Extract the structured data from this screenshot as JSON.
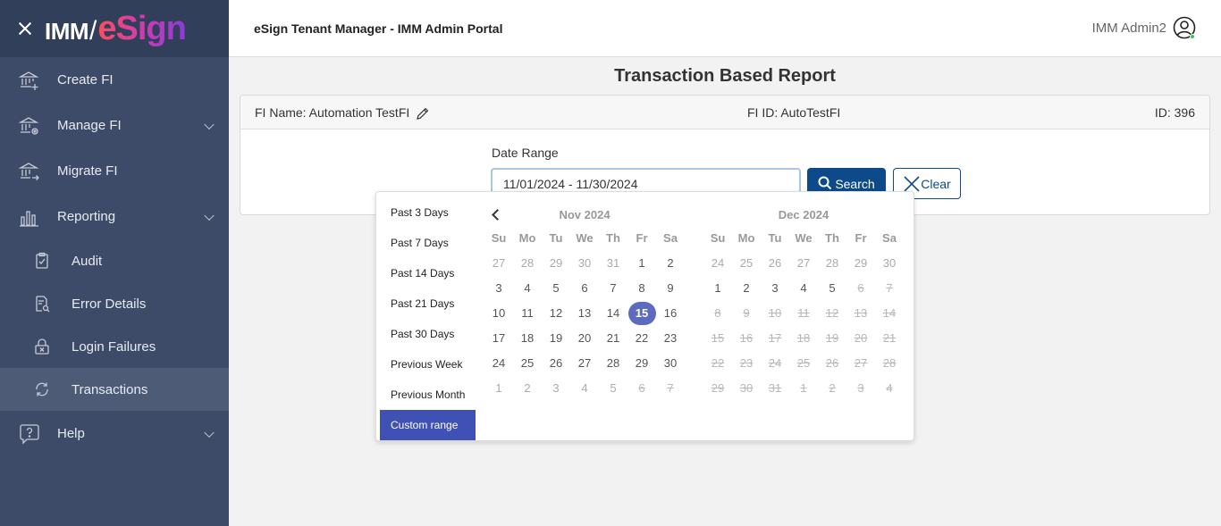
{
  "brand": {
    "imm": "IMM",
    "slash": "/",
    "esign": "eSign"
  },
  "sidebar": {
    "items": [
      {
        "label": "Create FI",
        "icon": "bank-plus-icon"
      },
      {
        "label": "Manage FI",
        "icon": "bank-gear-icon"
      },
      {
        "label": "Migrate FI",
        "icon": "bank-arrow-icon"
      },
      {
        "label": "Reporting",
        "icon": "bar-chart-icon"
      }
    ],
    "reporting_sub": [
      {
        "label": "Audit",
        "icon": "clipboard-check-icon"
      },
      {
        "label": "Error Details",
        "icon": "document-search-icon"
      },
      {
        "label": "Login Failures",
        "icon": "lock-x-icon"
      },
      {
        "label": "Transactions",
        "icon": "sync-icon"
      }
    ],
    "help": {
      "label": "Help",
      "icon": "help-bubble-icon"
    }
  },
  "header": {
    "title": "eSign Tenant Manager - IMM Admin Portal",
    "user": "IMM Admin2"
  },
  "page": {
    "title": "Transaction Based Report",
    "fi_name": "FI Name: Automation TestFI",
    "fi_id": "FI ID: AutoTestFI",
    "id": "ID: 396",
    "date_label": "Date Range",
    "date_value": "11/01/2024 - 11/30/2024",
    "search_label": "Search",
    "clear_label": "Clear"
  },
  "picker": {
    "ranges": [
      "Past 3 Days",
      "Past 7 Days",
      "Past 14 Days",
      "Past 21 Days",
      "Past 30 Days",
      "Previous Week",
      "Previous Month",
      "Custom range"
    ],
    "active_range": "Custom range",
    "dow": [
      "Su",
      "Mo",
      "Tu",
      "We",
      "Th",
      "Fr",
      "Sa"
    ],
    "left": {
      "month": "Nov 2024",
      "days": [
        {
          "d": "27",
          "s": "off"
        },
        {
          "d": "28",
          "s": "off"
        },
        {
          "d": "29",
          "s": "off"
        },
        {
          "d": "30",
          "s": "off"
        },
        {
          "d": "31",
          "s": "off"
        },
        {
          "d": "1",
          "s": ""
        },
        {
          "d": "2",
          "s": ""
        },
        {
          "d": "3",
          "s": ""
        },
        {
          "d": "4",
          "s": ""
        },
        {
          "d": "5",
          "s": ""
        },
        {
          "d": "6",
          "s": ""
        },
        {
          "d": "7",
          "s": ""
        },
        {
          "d": "8",
          "s": ""
        },
        {
          "d": "9",
          "s": ""
        },
        {
          "d": "10",
          "s": ""
        },
        {
          "d": "11",
          "s": ""
        },
        {
          "d": "12",
          "s": ""
        },
        {
          "d": "13",
          "s": ""
        },
        {
          "d": "14",
          "s": ""
        },
        {
          "d": "15",
          "s": "sel"
        },
        {
          "d": "16",
          "s": ""
        },
        {
          "d": "17",
          "s": ""
        },
        {
          "d": "18",
          "s": ""
        },
        {
          "d": "19",
          "s": ""
        },
        {
          "d": "20",
          "s": ""
        },
        {
          "d": "21",
          "s": ""
        },
        {
          "d": "22",
          "s": ""
        },
        {
          "d": "23",
          "s": ""
        },
        {
          "d": "24",
          "s": ""
        },
        {
          "d": "25",
          "s": ""
        },
        {
          "d": "26",
          "s": ""
        },
        {
          "d": "27",
          "s": ""
        },
        {
          "d": "28",
          "s": ""
        },
        {
          "d": "29",
          "s": ""
        },
        {
          "d": "30",
          "s": ""
        },
        {
          "d": "1",
          "s": "off"
        },
        {
          "d": "2",
          "s": "off"
        },
        {
          "d": "3",
          "s": "off"
        },
        {
          "d": "4",
          "s": "off"
        },
        {
          "d": "5",
          "s": "off"
        },
        {
          "d": "6",
          "s": "dis"
        },
        {
          "d": "7",
          "s": "dis"
        }
      ]
    },
    "right": {
      "month": "Dec 2024",
      "days": [
        {
          "d": "24",
          "s": "off"
        },
        {
          "d": "25",
          "s": "off"
        },
        {
          "d": "26",
          "s": "off"
        },
        {
          "d": "27",
          "s": "off"
        },
        {
          "d": "28",
          "s": "off"
        },
        {
          "d": "29",
          "s": "off"
        },
        {
          "d": "30",
          "s": "off"
        },
        {
          "d": "1",
          "s": ""
        },
        {
          "d": "2",
          "s": ""
        },
        {
          "d": "3",
          "s": ""
        },
        {
          "d": "4",
          "s": ""
        },
        {
          "d": "5",
          "s": ""
        },
        {
          "d": "6",
          "s": "dis"
        },
        {
          "d": "7",
          "s": "dis"
        },
        {
          "d": "8",
          "s": "dis"
        },
        {
          "d": "9",
          "s": "dis"
        },
        {
          "d": "10",
          "s": "dis"
        },
        {
          "d": "11",
          "s": "dis"
        },
        {
          "d": "12",
          "s": "dis"
        },
        {
          "d": "13",
          "s": "dis"
        },
        {
          "d": "14",
          "s": "dis"
        },
        {
          "d": "15",
          "s": "dis"
        },
        {
          "d": "16",
          "s": "dis"
        },
        {
          "d": "17",
          "s": "dis"
        },
        {
          "d": "18",
          "s": "dis"
        },
        {
          "d": "19",
          "s": "dis"
        },
        {
          "d": "20",
          "s": "dis"
        },
        {
          "d": "21",
          "s": "dis"
        },
        {
          "d": "22",
          "s": "dis"
        },
        {
          "d": "23",
          "s": "dis"
        },
        {
          "d": "24",
          "s": "dis"
        },
        {
          "d": "25",
          "s": "dis"
        },
        {
          "d": "26",
          "s": "dis"
        },
        {
          "d": "27",
          "s": "dis"
        },
        {
          "d": "28",
          "s": "dis"
        },
        {
          "d": "29",
          "s": "dis"
        },
        {
          "d": "30",
          "s": "dis"
        },
        {
          "d": "31",
          "s": "dis"
        },
        {
          "d": "1",
          "s": "dis"
        },
        {
          "d": "2",
          "s": "dis"
        },
        {
          "d": "3",
          "s": "dis"
        },
        {
          "d": "4",
          "s": "dis"
        }
      ]
    }
  },
  "colors": {
    "sidebar_bg": "#3d4b69",
    "brand_bg": "#323f5b",
    "primary": "#0d4a8a",
    "range_active": "#3f51b5",
    "day_selected": "#5c6bc0"
  }
}
